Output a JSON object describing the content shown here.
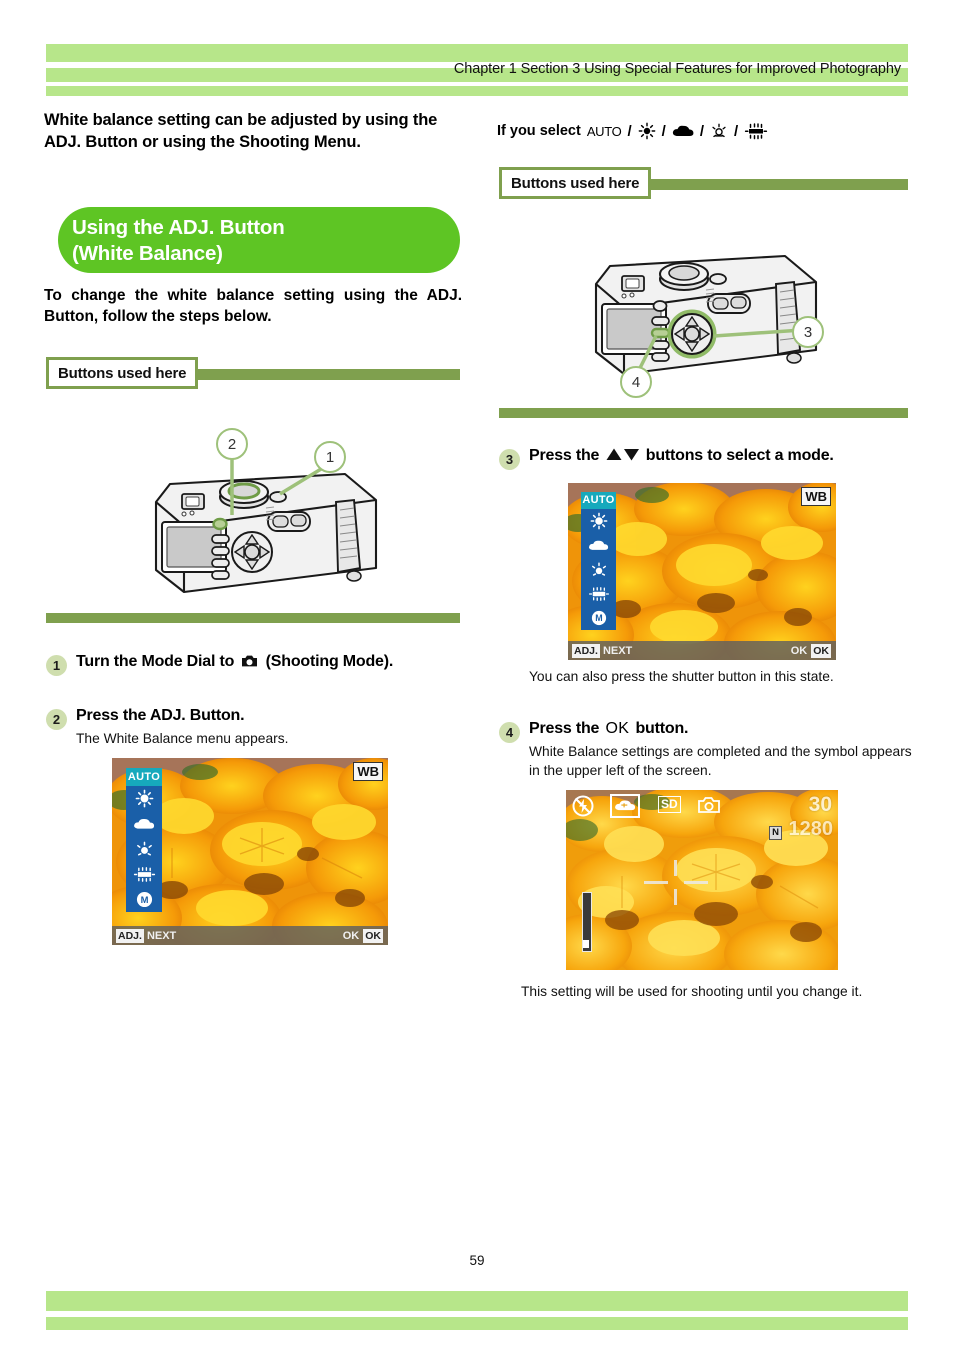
{
  "header": {
    "chapter_text": "Chapter 1 Section 3 Using Special Features for Improved Photography"
  },
  "footer": {
    "page_number": "59"
  },
  "colors": {
    "header_bar_green": "#b7e68a",
    "banner_green": "#5ec524",
    "rule_green": "#7fa04e",
    "step_circle_green": "#cfdeae",
    "callout_green": "#9ec17a",
    "lcd_menu_blue": "#1a5fa8",
    "lcd_auto_highlight": "#16a9bc"
  },
  "left_column": {
    "intro": "White balance setting can be adjusted by using the ADJ. Button or using the Shooting Menu.",
    "banner_title_line1": "Using the ADJ. Button",
    "banner_title_line2": "(White Balance)",
    "instruction": "To change the white balance setting using the ADJ. Button, follow the steps below.",
    "buttons_used_here": "Buttons used here",
    "callouts": [
      "2",
      "1"
    ],
    "steps": [
      {
        "number": "1",
        "title_before": "Turn the Mode Dial to",
        "icon": "camera-mode-icon",
        "title_after": "(Shooting Mode).",
        "sub": ""
      },
      {
        "number": "2",
        "title_before": "Press the ADJ. Button.",
        "icon": "",
        "title_after": "",
        "sub": "The White Balance menu appears."
      }
    ],
    "lcd": {
      "menu_label": "AUTO",
      "menu_icons": [
        "sun-icon",
        "cloud-icon",
        "tungsten-icon",
        "fluorescent-icon",
        "manual-wb-icon"
      ],
      "bar_tag": "ADJ.",
      "bar_label": "NEXT",
      "bar_ok_text": "OK",
      "bar_ok_tag": "OK",
      "wb_badge": "WB"
    }
  },
  "right_column": {
    "if_you_select_label": "If you select",
    "if_you_select_icons": [
      "AUTO",
      "sun-icon",
      "cloud-icon",
      "tungsten-icon",
      "fluorescent-icon"
    ],
    "if_you_select_separator": "/",
    "buttons_used_here": "Buttons used here",
    "callouts": [
      "3",
      "4"
    ],
    "steps": [
      {
        "number": "3",
        "title_before": "Press the",
        "icon": "up-down-arrows-icon",
        "title_after": "buttons to select a mode.",
        "sub": "You can also press the shutter button in this state."
      },
      {
        "number": "4",
        "title_before": "Press the",
        "icon": "ok-button-icon",
        "title_after": "button.",
        "sub": "White Balance settings are completed and the symbol appears in the upper left of the screen."
      }
    ],
    "lcd_menu": {
      "menu_label": "AUTO",
      "menu_icons": [
        "sun-icon",
        "cloud-icon",
        "tungsten-icon",
        "fluorescent-icon",
        "manual-wb-icon"
      ],
      "bar_tag": "ADJ.",
      "bar_label": "NEXT",
      "bar_ok_text": "OK",
      "bar_ok_tag": "OK",
      "wb_badge": "WB"
    },
    "lcd_result": {
      "flash_icon": "flash-off-icon",
      "wb_selected_icon": "cloud-wb-icon",
      "card_icon": "SD",
      "mode_icon": "camera-icon",
      "shots_remaining": "30",
      "quality_badge": "N",
      "resolution": "1280"
    },
    "closing_note": "This setting will be used for shooting until you change it."
  }
}
